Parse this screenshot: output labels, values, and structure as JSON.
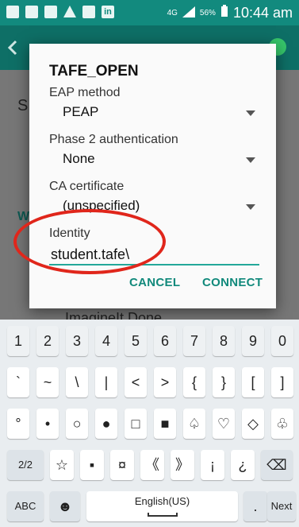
{
  "status_bar": {
    "linkedin_glyph": "in",
    "network_type": "4G",
    "battery": "56%",
    "time": "10:44 am",
    "icons": [
      "mail-icon",
      "keyboard-icon",
      "gallery-icon",
      "alert-icon",
      "gmail-icon",
      "linkedin-icon"
    ]
  },
  "background": {
    "section_letter": "S",
    "wifi_letter": "W",
    "network_partial": "ImagineIt Done"
  },
  "dialog": {
    "title": "TAFE_OPEN",
    "eap_label": "EAP method",
    "eap_value": "PEAP",
    "phase2_label": "Phase 2 authentication",
    "phase2_value": "None",
    "ca_label": "CA certificate",
    "ca_value": "(unspecified)",
    "identity_label": "Identity",
    "identity_value": "student.tafe\\",
    "cancel": "CANCEL",
    "connect": "CONNECT"
  },
  "keyboard": {
    "row_numbers": [
      "1",
      "2",
      "3",
      "4",
      "5",
      "6",
      "7",
      "8",
      "9",
      "0"
    ],
    "row_symbols1": [
      "`",
      "~",
      "\\",
      "|",
      "<",
      ">",
      "{",
      "}",
      "[",
      "]"
    ],
    "row_symbols2": [
      "°",
      "•",
      "○",
      "●",
      "□",
      "■",
      "♤",
      "♡",
      "◇",
      "♧"
    ],
    "row_symbols3": [
      "2/2",
      "☆",
      "▪",
      "¤",
      "《",
      "》",
      "¡",
      "¿",
      "⌫"
    ],
    "row_bottom": [
      "ABC",
      "☻",
      "English(US)",
      ".",
      "Next"
    ]
  }
}
